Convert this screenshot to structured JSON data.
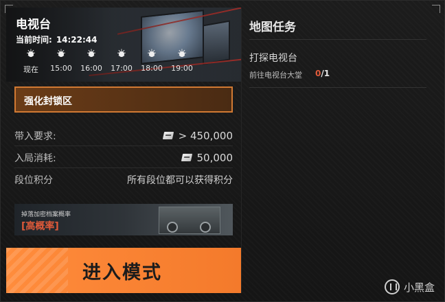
{
  "location": {
    "title": "电视台",
    "time_label": "当前时间:",
    "time_value": "14:22:44"
  },
  "weather": [
    {
      "icon": "sun-icon",
      "label": "现在"
    },
    {
      "icon": "sun-icon",
      "label": "15:00"
    },
    {
      "icon": "sun-icon",
      "label": "16:00"
    },
    {
      "icon": "sun-icon",
      "label": "17:00"
    },
    {
      "icon": "sun-icon",
      "label": "18:00"
    },
    {
      "icon": "sun-icon",
      "label": "19:00"
    }
  ],
  "zone": {
    "label": "强化封锁区"
  },
  "requirements": {
    "carry_label": "带入要求:",
    "carry_value": "> 450,000",
    "cost_label": "入局消耗:",
    "cost_value": "50,000",
    "rank_label": "段位积分",
    "rank_value": "所有段位都可以获得积分"
  },
  "drop_rate": {
    "title": "掉落加密档案概率",
    "value": "[高概率]"
  },
  "enter_button": {
    "label": "进入模式"
  },
  "map_tasks": {
    "title": "地图任务",
    "tasks": [
      {
        "name": "打探电视台",
        "detail": "前往电视台大堂",
        "current": "0",
        "total": "/1"
      }
    ]
  },
  "watermark": {
    "text": "小黑盒"
  },
  "colors": {
    "accent_orange": "#f47a2b",
    "zone_border": "#d27a33",
    "highlight_red": "#e05a3a"
  }
}
